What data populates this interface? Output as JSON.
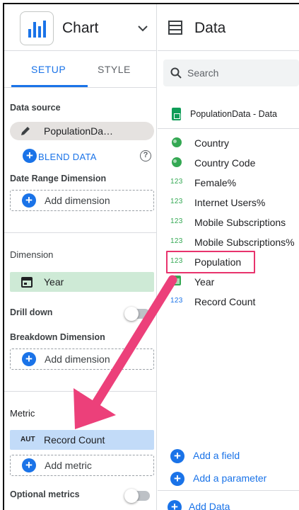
{
  "left_panel": {
    "chart_title": "Chart",
    "tabs": [
      {
        "label": "SETUP",
        "active": true
      },
      {
        "label": "STYLE",
        "active": false
      }
    ],
    "data_source": {
      "label": "Data source",
      "source_name": "PopulationDa…",
      "blend_label": "BLEND DATA"
    },
    "date_range": {
      "label": "Date Range Dimension",
      "add_label": "Add dimension"
    },
    "dimension": {
      "label": "Dimension",
      "field": "Year"
    },
    "drill_down": {
      "label": "Drill down",
      "enabled": false
    },
    "breakdown": {
      "label": "Breakdown Dimension",
      "add_label": "Add dimension"
    },
    "metric": {
      "label": "Metric",
      "tag": "AUT",
      "field": "Record Count",
      "add_label": "Add metric"
    },
    "optional_metrics": {
      "label": "Optional metrics",
      "enabled": false
    }
  },
  "right_panel": {
    "title": "Data",
    "search_placeholder": "Search",
    "source_name": "PopulationData - Data",
    "fields": [
      {
        "icon": "globe-icon",
        "label": "Country"
      },
      {
        "icon": "globe-icon",
        "label": "Country Code"
      },
      {
        "icon": "number-icon",
        "label": "Female%"
      },
      {
        "icon": "number-icon",
        "label": "Internet Users%"
      },
      {
        "icon": "number-icon",
        "label": "Mobile Subscriptions"
      },
      {
        "icon": "number-icon",
        "label": "Mobile Subscriptions%"
      },
      {
        "icon": "number-icon",
        "label": "Population"
      },
      {
        "icon": "calendar-icon",
        "label": "Year"
      },
      {
        "icon": "number-icon-blue",
        "label": "Record Count"
      }
    ],
    "number_icon_text": "123",
    "add_field": "Add a field",
    "add_parameter": "Add a parameter",
    "add_data": "Add Data"
  },
  "colors": {
    "accent": "#1a73e8",
    "dimension_green": "#ceead6",
    "metric_blue": "#c2dbf8",
    "highlight_pink": "#e8336d"
  }
}
